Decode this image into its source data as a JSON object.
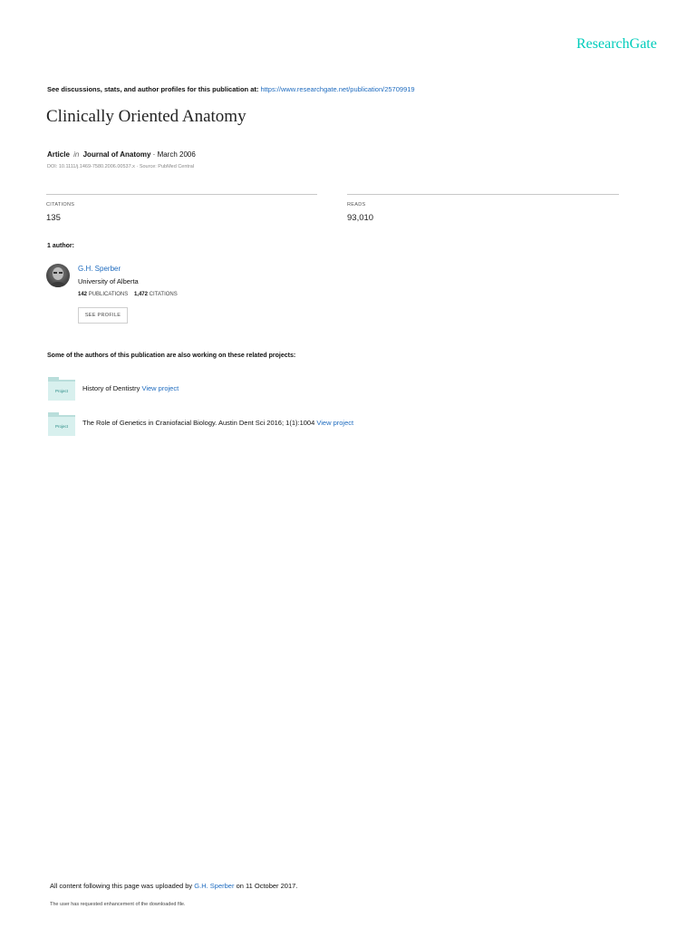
{
  "brand": "ResearchGate",
  "header": {
    "discussion_text": "See discussions, stats, and author profiles for this publication at:",
    "url": "https://www.researchgate.net/publication/25709919"
  },
  "publication": {
    "title": "Clinically Oriented Anatomy",
    "type": "Article",
    "in_word": "in",
    "journal": "Journal of Anatomy",
    "date": "March 2006",
    "doi_line": "DOI: 10.1111/j.1469-7580.2006.00537.x · Source: PubMed Central"
  },
  "stats": {
    "citations_label": "CITATIONS",
    "citations_value": "135",
    "reads_label": "READS",
    "reads_value": "93,010"
  },
  "authors": {
    "heading": "1 author:",
    "list": [
      {
        "name": "G.H. Sperber",
        "institution": "University of Alberta",
        "publications_count": "142",
        "publications_label": "PUBLICATIONS",
        "citations_count": "1,472",
        "citations_label": "CITATIONS",
        "button": "SEE PROFILE"
      }
    ]
  },
  "projects": {
    "heading": "Some of the authors of this publication are also working on these related projects:",
    "icon_label": "Project",
    "items": [
      {
        "title": "History of Dentistry",
        "link": "View project"
      },
      {
        "title": "The Role of Genetics in Craniofacial Biology. Austin Dent Sci 2016; 1(1):1004",
        "link": "View project"
      }
    ]
  },
  "footer": {
    "uploaded_prefix": "All content following this page was uploaded by",
    "uploader": "G.H. Sperber",
    "uploaded_suffix": "on 11 October 2017.",
    "note": "The user has requested enhancement of the downloaded file."
  }
}
